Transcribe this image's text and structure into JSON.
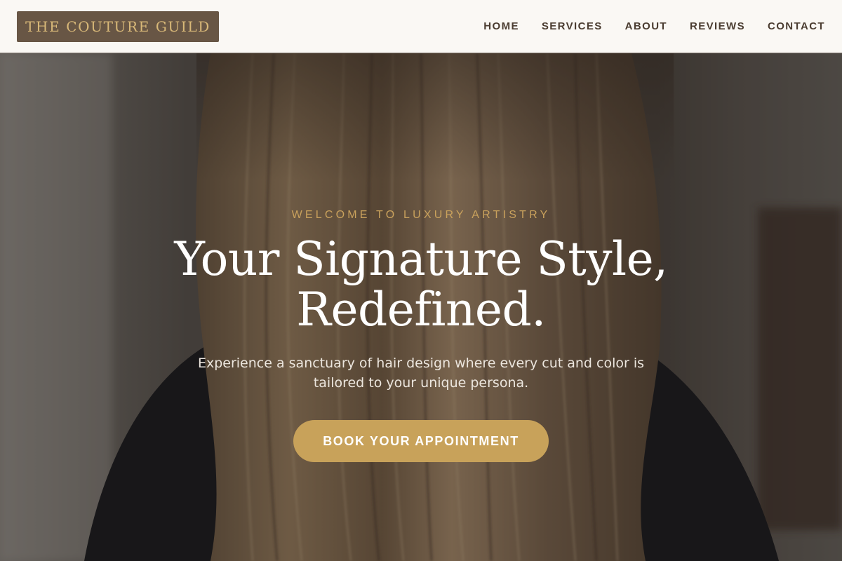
{
  "header": {
    "logo_text": "THE COUTURE GUILD",
    "nav": [
      {
        "label": "HOME"
      },
      {
        "label": "SERVICES"
      },
      {
        "label": "ABOUT"
      },
      {
        "label": "REVIEWS"
      },
      {
        "label": "CONTACT"
      }
    ]
  },
  "hero": {
    "eyebrow": "WELCOME TO LUXURY ARTISTRY",
    "headline": "Your Signature Style, Redefined.",
    "subtext": "Experience a sanctuary of hair design where every cut and color is tailored to your unique persona.",
    "cta_label": "BOOK YOUR APPOINTMENT"
  },
  "colors": {
    "brand_gold": "#c8a25a",
    "logo_bg": "#685645",
    "header_bg": "#faf8f4",
    "nav_text": "#4a3c30"
  }
}
